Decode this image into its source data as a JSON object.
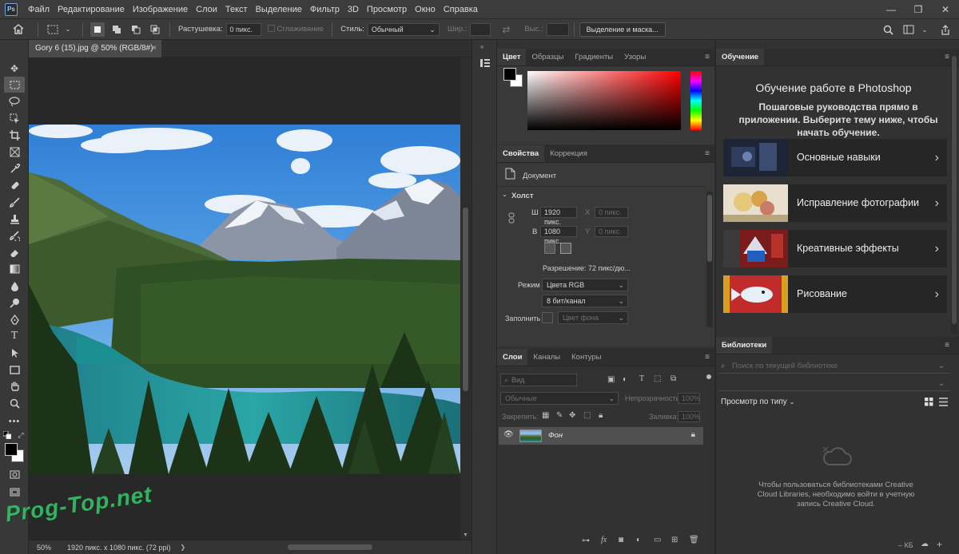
{
  "app": {
    "logo": "Ps"
  },
  "menu": [
    "Файл",
    "Редактирование",
    "Изображение",
    "Слои",
    "Текст",
    "Выделение",
    "Фильтр",
    "3D",
    "Просмотр",
    "Окно",
    "Справка"
  ],
  "window_controls": {
    "minimize": "—",
    "restore": "❐",
    "close": "✕"
  },
  "options_bar": {
    "feather_label": "Растушевка:",
    "feather_value": "0 пикс.",
    "antialias_label": "Сглаживание",
    "style_label": "Стиль:",
    "style_value": "Обычный",
    "width_label": "Шир.:",
    "height_label": "Выс.:",
    "select_mask_button": "Выделение и маска..."
  },
  "document": {
    "tab_title": "Gory 6 (15).jpg @ 50% (RGB/8#)",
    "tab_close": "×",
    "zoom": "50%",
    "info": "1920 пикс. x 1080 пикс. (72 ppi)"
  },
  "color_panel": {
    "tabs": [
      "Цвет",
      "Образцы",
      "Градиенты",
      "Узоры"
    ],
    "active_tab": 0
  },
  "properties_panel": {
    "tabs": [
      "Свойства",
      "Коррекция"
    ],
    "doc_label": "Документ",
    "section": "Холст",
    "w_label": "Ш",
    "w_value": "1920 пикс.",
    "x_label": "X",
    "x_value": "0 пикс.",
    "h_label": "В",
    "h_value": "1080 пикс.",
    "y_label": "Y",
    "y_value": "0 пикс.",
    "resolution": "Разрешение: 72 пикс/дю...",
    "mode_label": "Режим",
    "mode_value": "Цвета RGB",
    "depth_value": "8 бит/канал",
    "fill_label": "Заполнить",
    "fill_value": "Цвет фона"
  },
  "layers_panel": {
    "tabs": [
      "Слои",
      "Каналы",
      "Контуры"
    ],
    "search_placeholder": "Вид",
    "blend_mode": "Обычные",
    "opacity_label": "Непрозрачность:",
    "opacity_value": "100%",
    "lock_label": "Закрепить:",
    "fill_label": "Заливка:",
    "fill_value": "100%",
    "layers": [
      {
        "name": "Фон"
      }
    ]
  },
  "learn_panel": {
    "tab": "Обучение",
    "title": "Обучение работе в Photoshop",
    "subtitle": "Пошаговые руководства прямо в приложении. Выберите тему ниже, чтобы начать обучение.",
    "cards": [
      {
        "label": "Основные навыки"
      },
      {
        "label": "Исправление фотографии"
      },
      {
        "label": "Креативные эффекты"
      },
      {
        "label": "Рисование"
      }
    ]
  },
  "libraries_panel": {
    "tab": "Библиотеки",
    "search_placeholder": "Поиск по текущей библиотеке",
    "view_by_type": "Просмотр по типу",
    "message": "Чтобы пользоваться библиотеками Creative Cloud Libraries, необходимо войти в учетную запись Creative Cloud.",
    "size_label": "– КБ"
  },
  "watermark": "Prog-Top.net"
}
